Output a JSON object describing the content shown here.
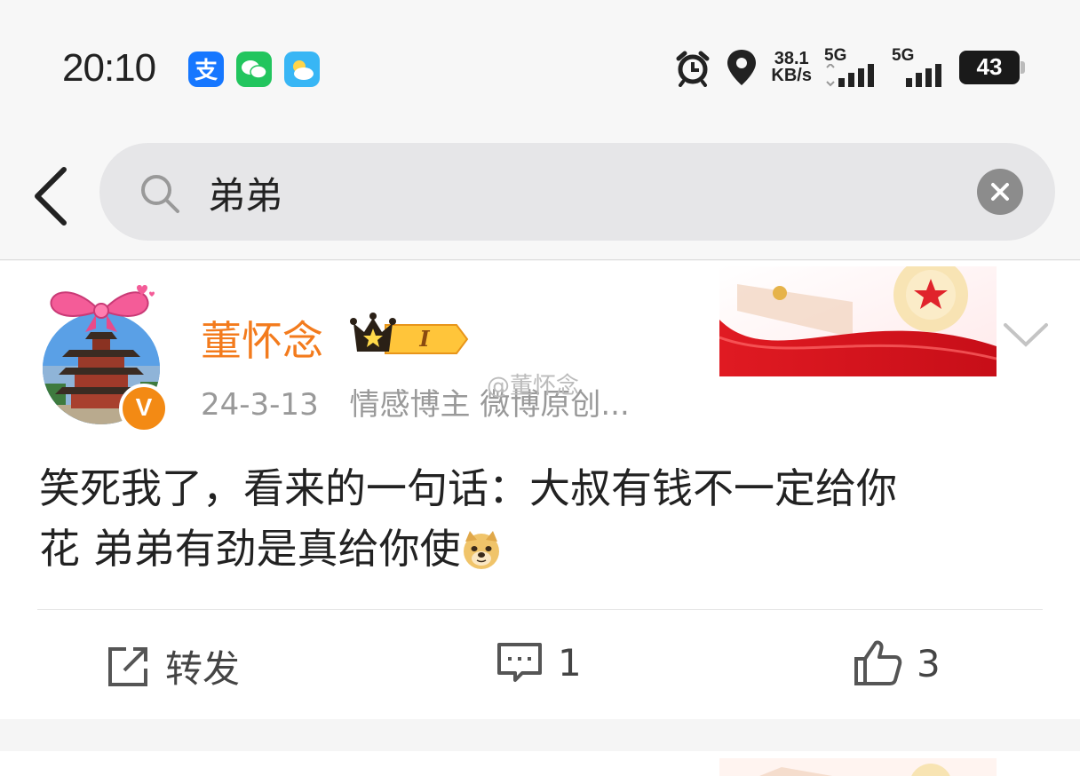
{
  "status_bar": {
    "time": "20:10",
    "app_icons": [
      "alipay-icon",
      "wechat-icon",
      "weather-icon"
    ],
    "net_speed_value": "38.1",
    "net_speed_unit": "KB/s",
    "signal_1": "5G",
    "signal_2": "5G",
    "battery": "43"
  },
  "search": {
    "query": "弟弟"
  },
  "post": {
    "username": "董怀念",
    "level_badge": "I",
    "date": "24-3-13",
    "source": "情感博主 微博原创...",
    "watermark": "@董怀念",
    "content_line1": "笑死我了，看来的一句话：大叔有钱不一定给你",
    "content_line2": "花 弟弟有劲是真给你使",
    "actions": {
      "repost_label": "转发",
      "comment_count": "1",
      "like_count": "3"
    }
  },
  "colors": {
    "accent_orange": "#f37b1d",
    "verified_badge": "#f38a14",
    "search_bg": "#e6e6e8"
  }
}
